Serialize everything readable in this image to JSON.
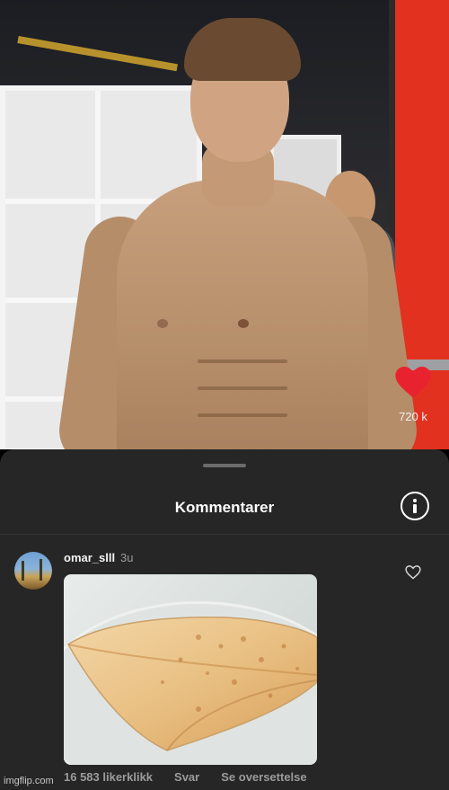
{
  "video": {
    "like_count": "720 k"
  },
  "comments_sheet": {
    "title": "Kommentarer",
    "comment": {
      "username": "omar_slll",
      "time_ago": "3u",
      "likes_text": "16 583 likerklikk",
      "reply_label": "Svar",
      "translate_label": "Se oversettelse"
    }
  },
  "watermark": "imgflip.com",
  "colors": {
    "sheet_bg": "#262626",
    "like_red": "#e8232f",
    "secondary_text": "#9b9b9b"
  },
  "icons": [
    "heart-icon",
    "info-icon",
    "heart-outline-icon"
  ]
}
